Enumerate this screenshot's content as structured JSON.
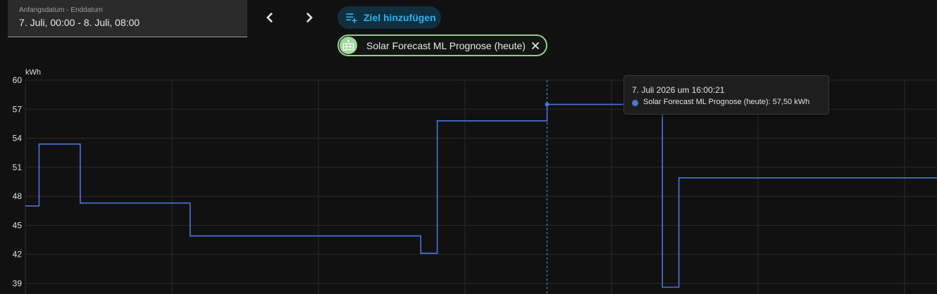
{
  "date_picker": {
    "label": "Anfangsdatum - Enddatum",
    "value": "7. Juli, 00:00 - 8. Juli, 08:00"
  },
  "nav": {
    "prev_icon": "chevron-left-icon",
    "next_icon": "chevron-right-icon"
  },
  "add_target": {
    "label": "Ziel hinzufügen",
    "icon": "playlist-plus-icon",
    "color": "#2ab1ef"
  },
  "chip": {
    "label": "Solar Forecast ML Prognose (heute)",
    "icon": "solar-panel-icon",
    "close_icon": "close-icon",
    "color": "#8fcf8a"
  },
  "tooltip": {
    "title": "7. Juli 2026 um 16:00:21",
    "value": "Solar Forecast ML Prognose (heute): 57,50 kWh"
  },
  "chart_data": {
    "type": "line",
    "step": true,
    "ylabel": "kWh",
    "ylim": [
      37.9,
      60
    ],
    "yticks": [
      60,
      57,
      54,
      51,
      48,
      45,
      42,
      39
    ],
    "grid": true,
    "series": [
      {
        "name": "Solar Forecast ML Prognose (heute)",
        "color": "#4a76d8",
        "x": [
          0,
          0.25,
          1.0,
          3.0,
          7.2,
          7.5,
          9.5,
          11.3,
          11.6,
          11.9,
          16.0,
          16.4,
          16.6
        ],
        "values": [
          47,
          53.4,
          47.3,
          43.9,
          42.1,
          55.8,
          57.5,
          57.5,
          38.6,
          49.9,
          49.9,
          49.9,
          49.9
        ]
      }
    ],
    "hover_x": 9.5,
    "accent": "#4a76d8"
  }
}
